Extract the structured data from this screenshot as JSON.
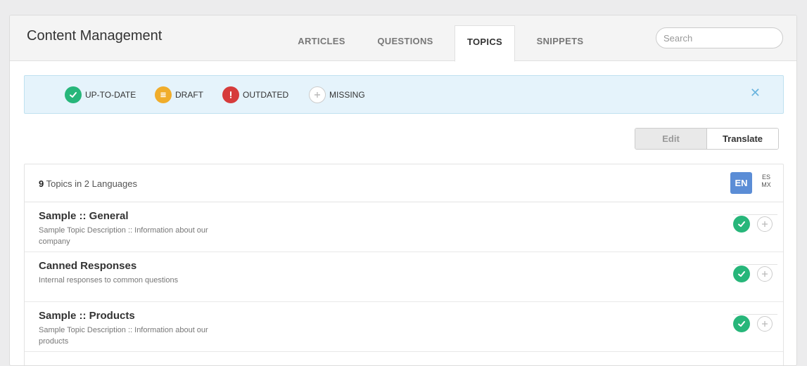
{
  "app": {
    "title": "Content Management"
  },
  "tabs": [
    {
      "label": "ARTICLES"
    },
    {
      "label": "QUESTIONS"
    },
    {
      "label": "TOPICS"
    },
    {
      "label": "SNIPPETS"
    }
  ],
  "search": {
    "placeholder": "Search",
    "value": ""
  },
  "legend": {
    "items": [
      {
        "label": "UP-TO-DATE",
        "icon": "check-icon",
        "color": "#27b67a"
      },
      {
        "label": "DRAFT",
        "icon": "lines-icon",
        "color": "#f0ad2b"
      },
      {
        "label": "OUTDATED",
        "icon": "exclamation-icon",
        "color": "#d63b3b"
      },
      {
        "label": "MISSING",
        "icon": "plus-icon",
        "color": "#ffffff"
      }
    ],
    "close_glyph": "✕"
  },
  "mode": {
    "edit_label": "Edit",
    "translate_label": "Translate",
    "active": "Edit"
  },
  "list": {
    "count": "9",
    "count_suffix": " Topics in 2 Languages",
    "lang_active": "EN",
    "lang_other_line1": "ES",
    "lang_other_line2": "MX",
    "rows": [
      {
        "title": "Sample :: General",
        "description": "Sample Topic Description :: Information about our company",
        "status": "up-to-date"
      },
      {
        "title": "Canned Responses",
        "description": "Internal responses to common questions",
        "status": "up-to-date"
      },
      {
        "title": "Sample :: Products",
        "description": "Sample Topic Description :: Information about our products",
        "status": "up-to-date"
      }
    ]
  }
}
